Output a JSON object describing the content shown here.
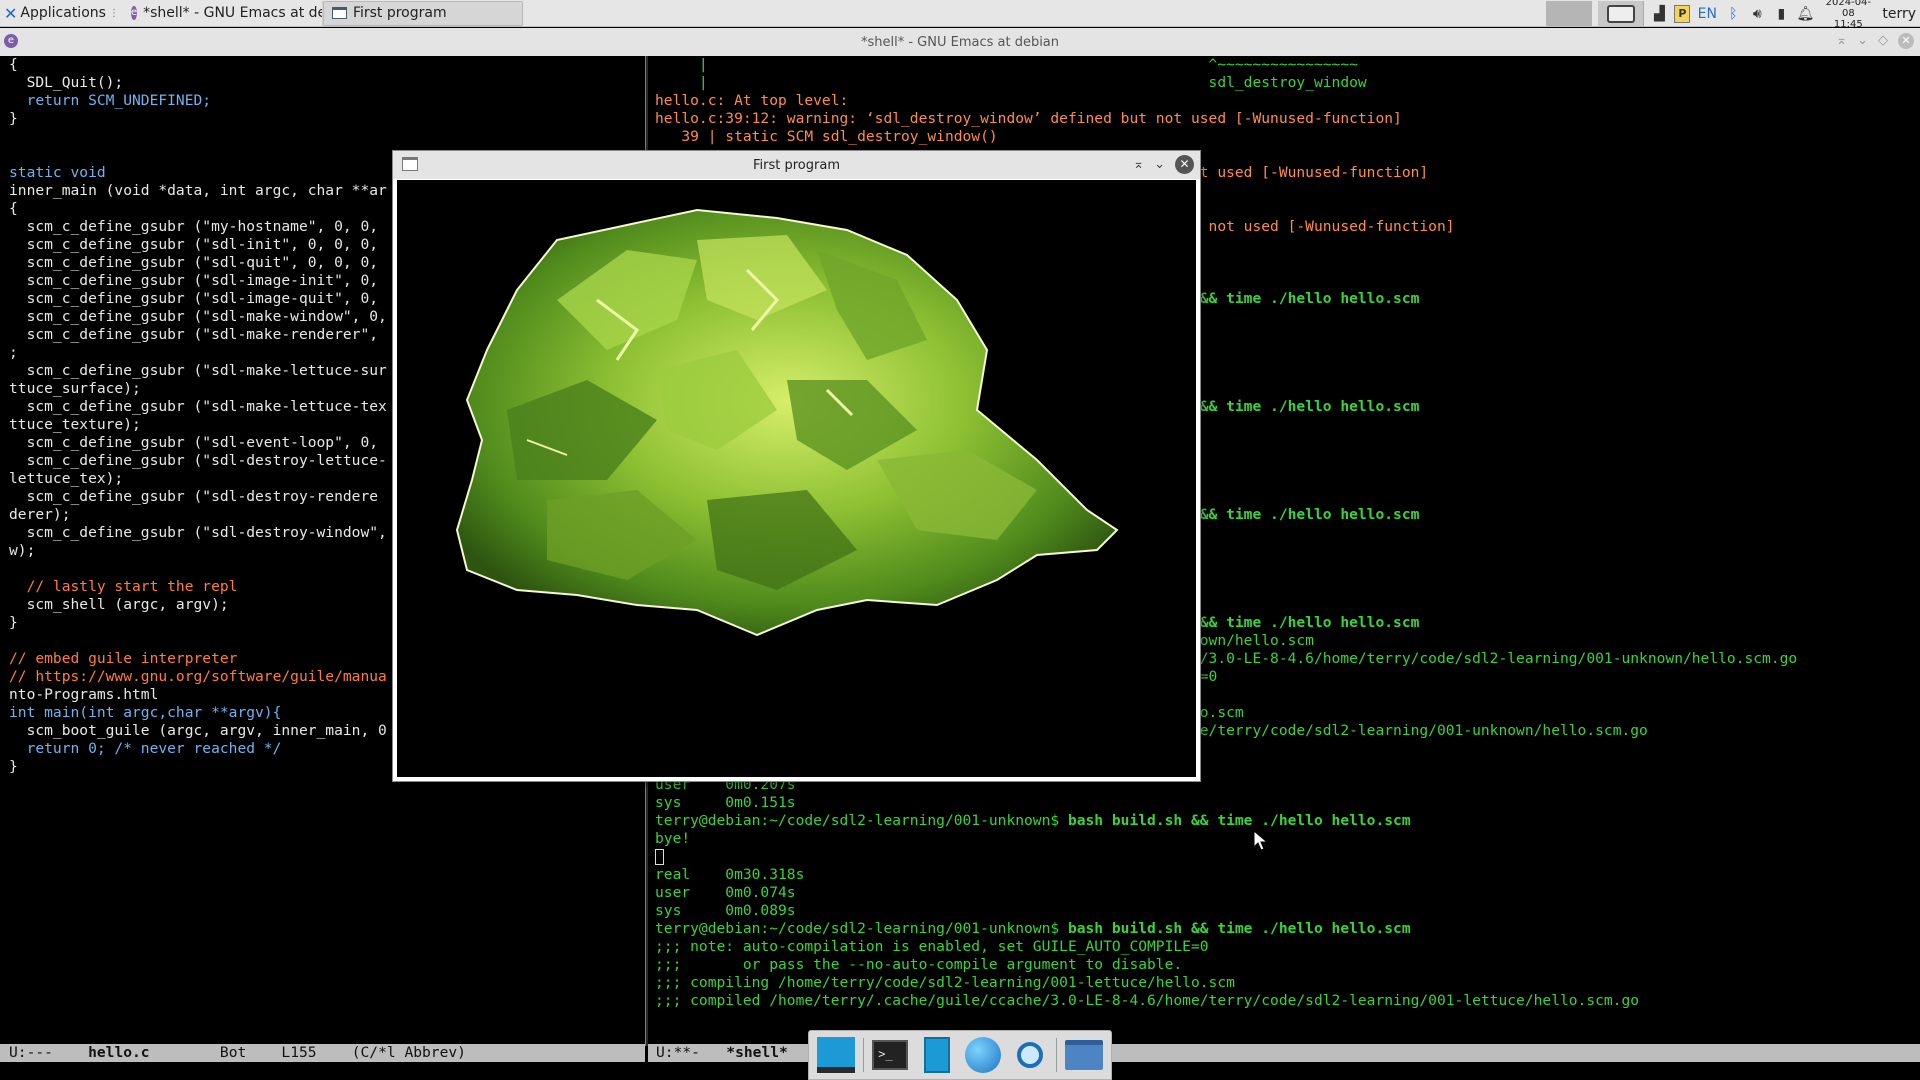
{
  "top_panel": {
    "applications_label": "Applications",
    "tasks": [
      {
        "title": "*shell* - GNU Emacs at de..."
      },
      {
        "title": "First program"
      }
    ],
    "tray": {
      "language": "EN",
      "date": "2024-04-08",
      "time": "11:45",
      "user": "terry"
    }
  },
  "emacs_frame": {
    "title": "*shell* - GNU Emacs at debian"
  },
  "left_pane": {
    "lines": [
      "{",
      "  SDL_Quit();",
      "  return SCM_UNDEFINED;",
      "}",
      "",
      "",
      "static void",
      "inner_main (void *data, int argc, char **ar",
      "{",
      "  scm_c_define_gsubr (\"my-hostname\", 0, 0,",
      "  scm_c_define_gsubr (\"sdl-init\", 0, 0, 0,",
      "  scm_c_define_gsubr (\"sdl-quit\", 0, 0, 0,",
      "  scm_c_define_gsubr (\"sdl-image-init\", 0,",
      "  scm_c_define_gsubr (\"sdl-image-quit\", 0,",
      "  scm_c_define_gsubr (\"sdl-make-window\", 0,",
      "  scm_c_define_gsubr (\"sdl-make-renderer\",",
      ";",
      "  scm_c_define_gsubr (\"sdl-make-lettuce-sur",
      "ttuce_surface);",
      "  scm_c_define_gsubr (\"sdl-make-lettuce-tex",
      "ttuce_texture);",
      "  scm_c_define_gsubr (\"sdl-event-loop\", 0,",
      "  scm_c_define_gsubr (\"sdl-destroy-lettuce-",
      "lettuce_tex);",
      "  scm_c_define_gsubr (\"sdl-destroy-rendere",
      "derer);",
      "  scm_c_define_gsubr (\"sdl-destroy-window\",",
      "w);",
      "",
      "  // lastly start the repl",
      "  scm_shell (argc, argv);",
      "}",
      "",
      "// embed guile interpreter",
      "// https://www.gnu.org/software/guile/manua",
      "nto-Programs.html",
      "int main(int argc,char **argv){",
      "  scm_boot_guile (argc, argv, inner_main, 0",
      "  return 0; /* never reached */",
      "}"
    ],
    "modeline": {
      "status": "U:---",
      "buffer": "hello.c",
      "position": "Bot",
      "line": "L155",
      "mode": "(C/*l Abbrev)"
    }
  },
  "right_pane": {
    "lines": [
      {
        "t": "     |                                                         ^~~~~~~~~~~~~~~~~",
        "c": "c-green"
      },
      {
        "t": "     |                                                         sdl_destroy_window",
        "c": "c-green"
      },
      {
        "t": "hello.c: At top level:",
        "c": "c-warn"
      },
      {
        "t": "hello.c:39:12: warning: ‘sdl_destroy_window’ defined but not used [-Wunused-function]",
        "c": "c-warn"
      },
      {
        "t": "   39 | static SCM sdl_destroy_window()",
        "c": "c-warn"
      },
      {
        "t": "",
        "c": ""
      },
      {
        "t": "                                                              t used [-Wunused-function]",
        "c": "c-warn"
      },
      {
        "t": "",
        "c": ""
      },
      {
        "t": "",
        "c": ""
      },
      {
        "t": "                                                               not used [-Wunused-function]",
        "c": "c-warn"
      },
      {
        "t": "",
        "c": ""
      },
      {
        "t": "",
        "c": ""
      },
      {
        "t": "",
        "c": ""
      },
      {
        "t": "                                                              && time ./hello hello.scm",
        "c": "c-bold"
      },
      {
        "t": "",
        "c": ""
      },
      {
        "t": "",
        "c": ""
      },
      {
        "t": "",
        "c": ""
      },
      {
        "t": "",
        "c": ""
      },
      {
        "t": "",
        "c": ""
      },
      {
        "t": "                                                              && time ./hello hello.scm",
        "c": "c-bold"
      },
      {
        "t": "",
        "c": ""
      },
      {
        "t": "",
        "c": ""
      },
      {
        "t": "",
        "c": ""
      },
      {
        "t": "",
        "c": ""
      },
      {
        "t": "",
        "c": ""
      },
      {
        "t": "                                                              && time ./hello hello.scm",
        "c": "c-bold"
      },
      {
        "t": "",
        "c": ""
      },
      {
        "t": "",
        "c": ""
      },
      {
        "t": "",
        "c": ""
      },
      {
        "t": "",
        "c": ""
      },
      {
        "t": "",
        "c": ""
      },
      {
        "t": "                                                              && time ./hello hello.scm",
        "c": "c-bold"
      },
      {
        "t": "                                                              own/hello.scm",
        "c": "c-green"
      },
      {
        "t": "                                                              /3.0-LE-8-4.6/home/terry/code/sdl2-learning/001-unknown/hello.scm.go",
        "c": "c-green"
      },
      {
        "t": "                                                              =0",
        "c": "c-green"
      },
      {
        "t": "",
        "c": ""
      },
      {
        "t": "                                                              o.scm",
        "c": "c-green"
      },
      {
        "t": "                                                              e/terry/code/sdl2-learning/001-unknown/hello.scm.go",
        "c": "c-green"
      },
      {
        "t": "",
        "c": ""
      },
      {
        "t": "",
        "c": ""
      },
      {
        "t": "user    0m0.207s",
        "c": "c-green"
      },
      {
        "t": "sys     0m0.151s",
        "c": "c-green"
      },
      {
        "t": "terry@debian:~/code/sdl2-learning/001-unknown$ bash build.sh && time ./hello hello.scm",
        "c": "prompt"
      },
      {
        "t": "bye!",
        "c": "c-green"
      },
      {
        "t": "",
        "c": "cursor"
      },
      {
        "t": "real    0m30.318s",
        "c": "c-green"
      },
      {
        "t": "user    0m0.074s",
        "c": "c-green"
      },
      {
        "t": "sys     0m0.089s",
        "c": "c-green"
      },
      {
        "t": "terry@debian:~/code/sdl2-learning/001-unknown$ bash build.sh && time ./hello hello.scm",
        "c": "prompt"
      },
      {
        "t": ";;; note: auto-compilation is enabled, set GUILE_AUTO_COMPILE=0",
        "c": "c-green"
      },
      {
        "t": ";;;       or pass the --no-auto-compile argument to disable.",
        "c": "c-green"
      },
      {
        "t": ";;; compiling /home/terry/code/sdl2-learning/001-lettuce/hello.scm",
        "c": "c-green"
      },
      {
        "t": ";;; compiled /home/terry/.cache/guile/ccache/3.0-LE-8-4.6/home/terry/code/sdl2-learning/001-lettuce/hello.scm.go",
        "c": "c-green"
      }
    ],
    "modeline": {
      "status": "U:**-",
      "buffer": "*shell*"
    }
  },
  "sdl_window": {
    "title": "First program"
  },
  "dock": {
    "items": [
      "show-desktop",
      "terminal",
      "file-manager",
      "web-browser",
      "app-finder",
      "files-folder"
    ]
  },
  "colors": {
    "terminal_green": "#3ad43a",
    "warning_orange": "#ff8c4a",
    "keyword_blue": "#6fb3f0",
    "lettuce_green": "#7fb02a"
  }
}
